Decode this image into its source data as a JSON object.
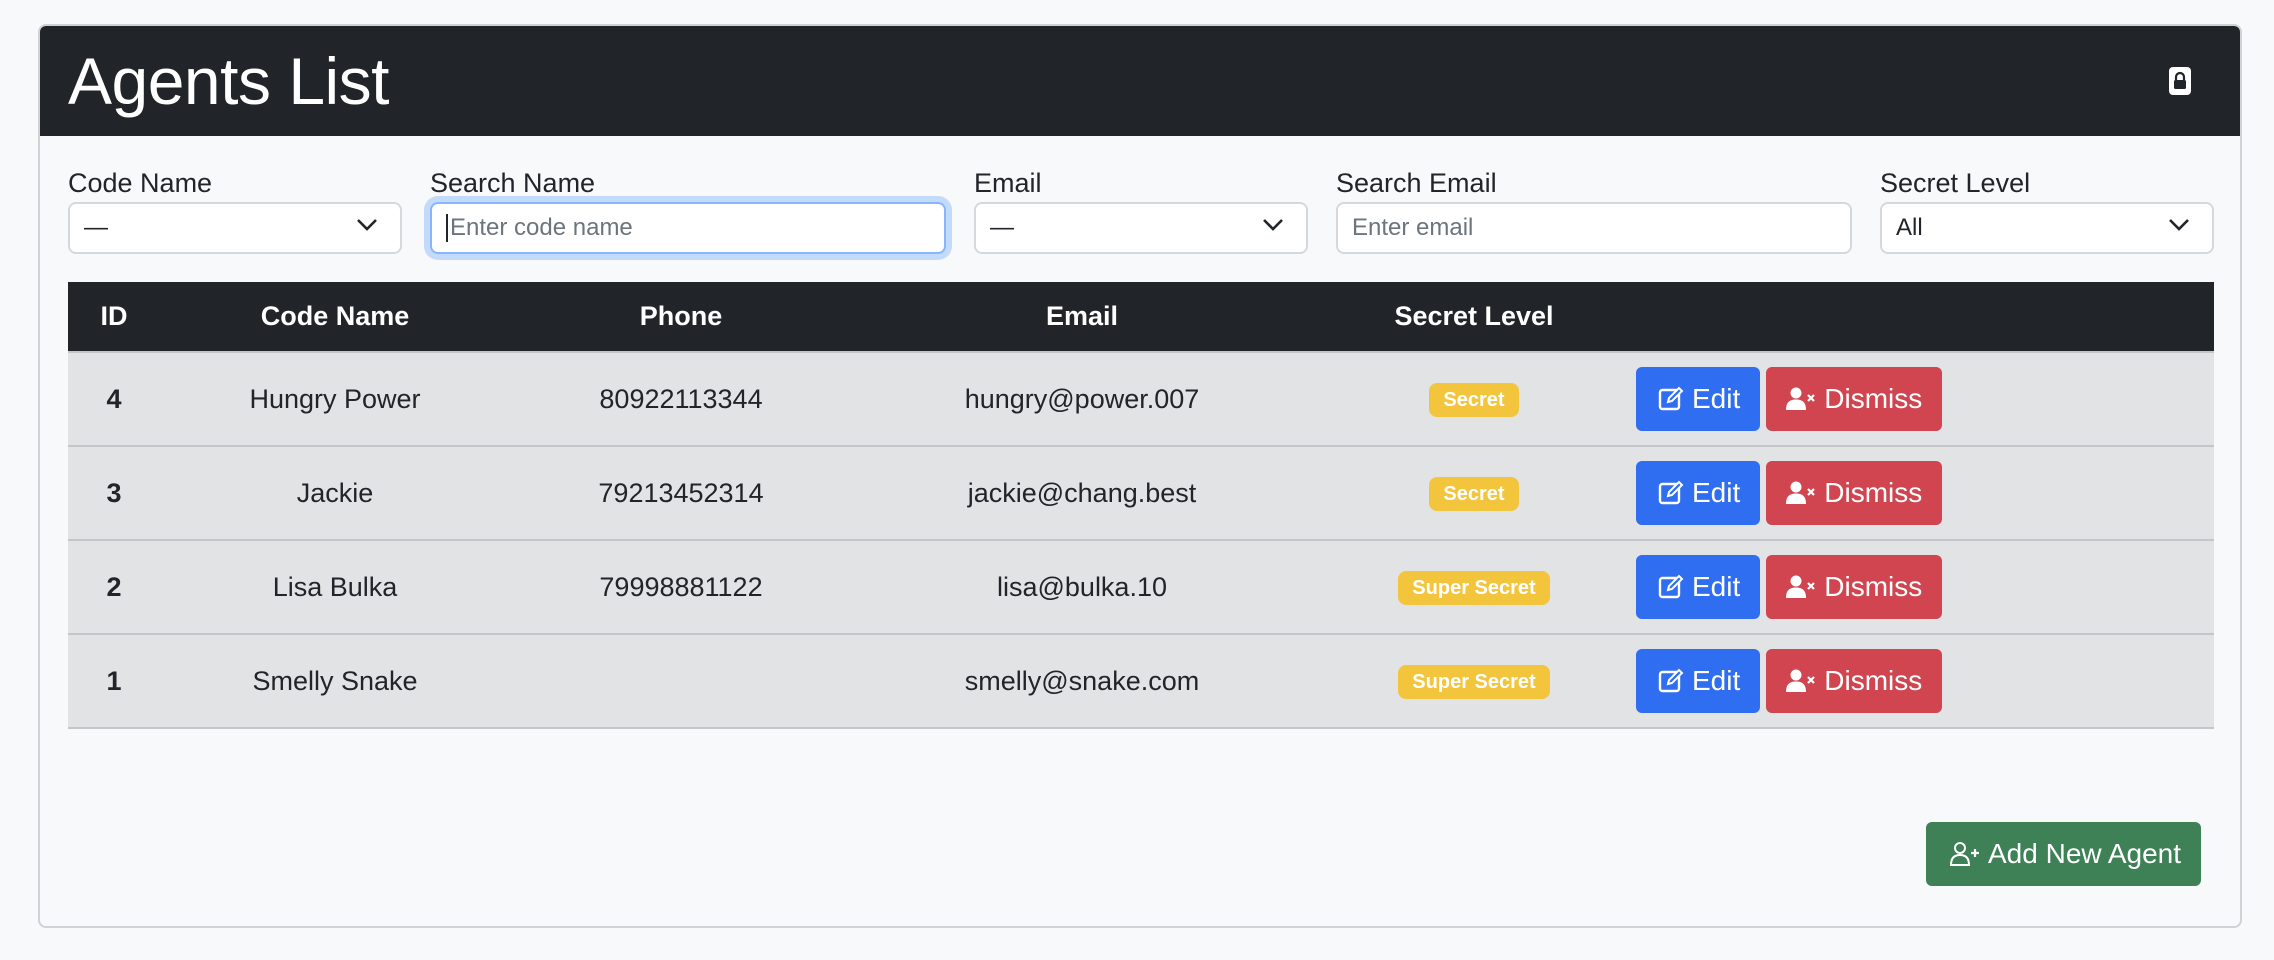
{
  "header": {
    "title": "Agents List",
    "lock_icon": "lock-icon"
  },
  "filters": {
    "code_name": {
      "label": "Code Name",
      "value": "—"
    },
    "search_name": {
      "label": "Search Name",
      "placeholder": "Enter code name",
      "value": ""
    },
    "email": {
      "label": "Email",
      "value": "—"
    },
    "search_email": {
      "label": "Search Email",
      "placeholder": "Enter email",
      "value": ""
    },
    "secret_level": {
      "label": "Secret Level",
      "value": "All"
    }
  },
  "table": {
    "columns": [
      "ID",
      "Code Name",
      "Phone",
      "Email",
      "Secret Level",
      ""
    ],
    "rows": [
      {
        "id": "4",
        "code_name": "Hungry Power",
        "phone": "80922113344",
        "email": "hungry@power.007",
        "level": "Secret"
      },
      {
        "id": "3",
        "code_name": "Jackie",
        "phone": "79213452314",
        "email": "jackie@chang.best",
        "level": "Secret"
      },
      {
        "id": "2",
        "code_name": "Lisa Bulka",
        "phone": "79998881122",
        "email": "lisa@bulka.10",
        "level": "Super Secret"
      },
      {
        "id": "1",
        "code_name": "Smelly Snake",
        "phone": "",
        "email": "smelly@snake.com",
        "level": "Super Secret"
      }
    ],
    "edit_label": "Edit",
    "dismiss_label": "Dismiss"
  },
  "add_button": {
    "label": "Add New Agent"
  },
  "colors": {
    "header_bg": "#212529",
    "edit": "#2f6ef0",
    "dismiss": "#d0454f",
    "add": "#3e8156",
    "badge": "#f2c53d",
    "row_bg": "#e2e3e5"
  }
}
